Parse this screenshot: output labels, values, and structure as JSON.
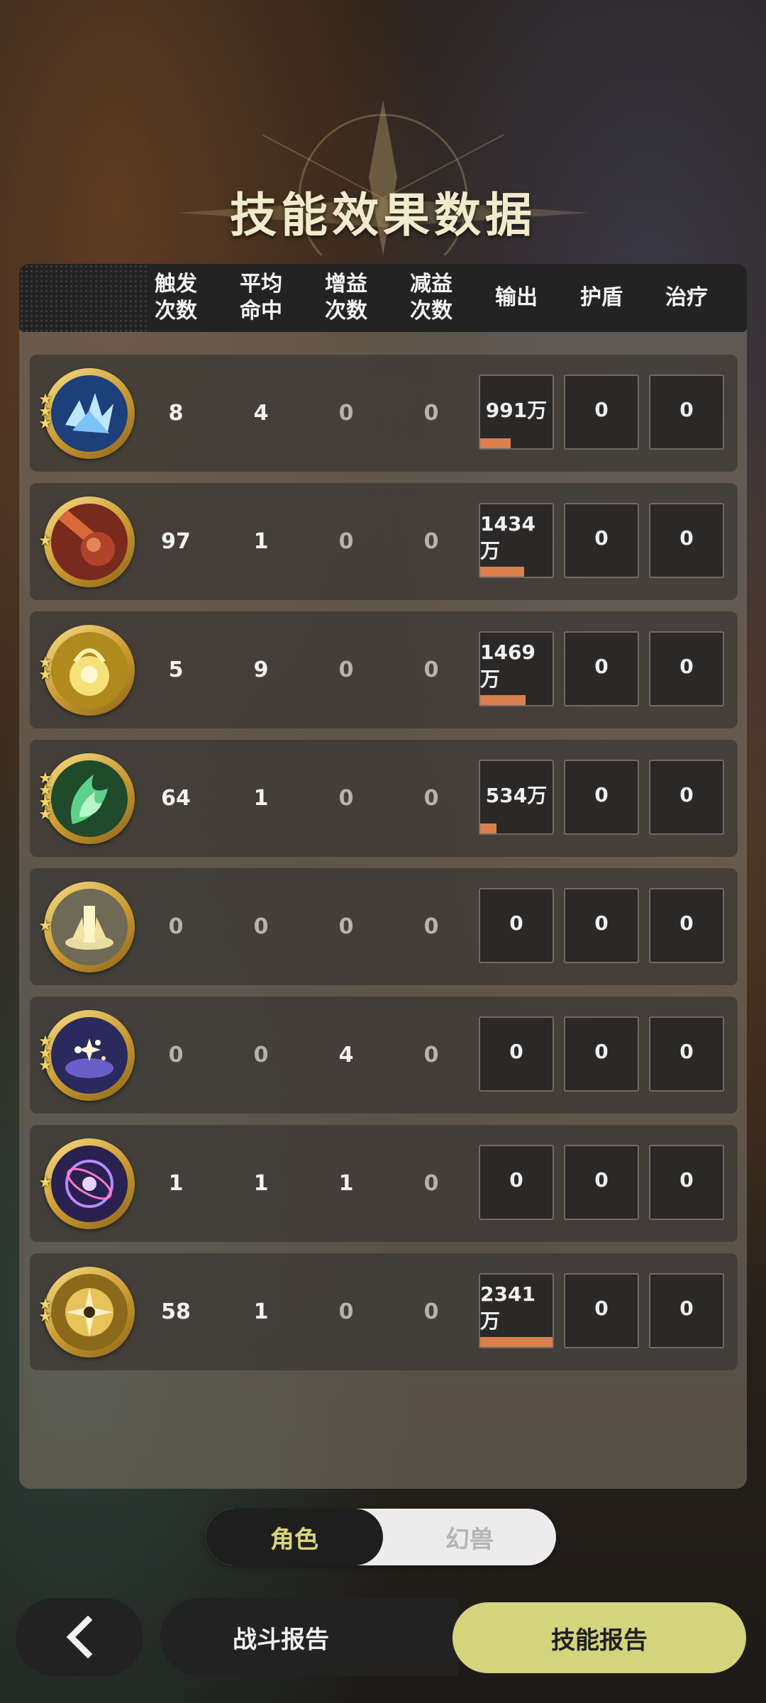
{
  "title": "技能效果数据",
  "columns": [
    {
      "label": "触发\n次数"
    },
    {
      "label": "平均\n命中"
    },
    {
      "label": "增益\n次数"
    },
    {
      "label": "减益\n次数"
    },
    {
      "label": "输出"
    },
    {
      "label": "护盾"
    },
    {
      "label": "治疗"
    }
  ],
  "rows": [
    {
      "icon": "ice-shard-skill-icon",
      "stars": "★★★",
      "trigger": "8",
      "avg_hit": "4",
      "buff": "0",
      "debuff": "0",
      "output": "991万",
      "output_fill": 0.42,
      "shield": "0",
      "heal": "0"
    },
    {
      "icon": "meteor-skill-icon",
      "stars": "★",
      "trigger": "97",
      "avg_hit": "1",
      "buff": "0",
      "debuff": "0",
      "output": "1434万",
      "output_fill": 0.61,
      "shield": "0",
      "heal": "0"
    },
    {
      "icon": "golden-spirit-skill-icon",
      "stars": "★★",
      "trigger": "5",
      "avg_hit": "9",
      "buff": "0",
      "debuff": "0",
      "output": "1469万",
      "output_fill": 0.63,
      "shield": "0",
      "heal": "0"
    },
    {
      "icon": "green-flame-skill-icon",
      "stars": "★★★★",
      "trigger": "64",
      "avg_hit": "1",
      "buff": "0",
      "debuff": "0",
      "output": "534万",
      "output_fill": 0.23,
      "shield": "0",
      "heal": "0"
    },
    {
      "icon": "light-pillar-skill-icon",
      "stars": "★",
      "trigger": "0",
      "avg_hit": "0",
      "buff": "0",
      "debuff": "0",
      "output": "0",
      "output_fill": 0,
      "shield": "0",
      "heal": "0"
    },
    {
      "icon": "starry-orb-skill-icon",
      "stars": "★★★",
      "trigger": "0",
      "avg_hit": "0",
      "buff": "4",
      "debuff": "0",
      "output": "0",
      "output_fill": 0,
      "shield": "0",
      "heal": "0"
    },
    {
      "icon": "arcane-sphere-skill-icon",
      "stars": "★",
      "trigger": "1",
      "avg_hit": "1",
      "buff": "1",
      "debuff": "0",
      "output": "0",
      "output_fill": 0,
      "shield": "0",
      "heal": "0"
    },
    {
      "icon": "golden-burst-skill-icon",
      "stars": "★★",
      "trigger": "58",
      "avg_hit": "1",
      "buff": "0",
      "debuff": "0",
      "output": "2341万",
      "output_fill": 1.0,
      "shield": "0",
      "heal": "0"
    }
  ],
  "toggle": {
    "active": "角色",
    "inactive": "幻兽"
  },
  "bottom": {
    "back_icon": "chevron-left-icon",
    "battle_report": "战斗报告",
    "skill_report": "技能报告"
  },
  "colors": {
    "accent": "#d3d47c",
    "output_bar": "#d9804e",
    "toggle_active_text": "#d9d57a"
  }
}
